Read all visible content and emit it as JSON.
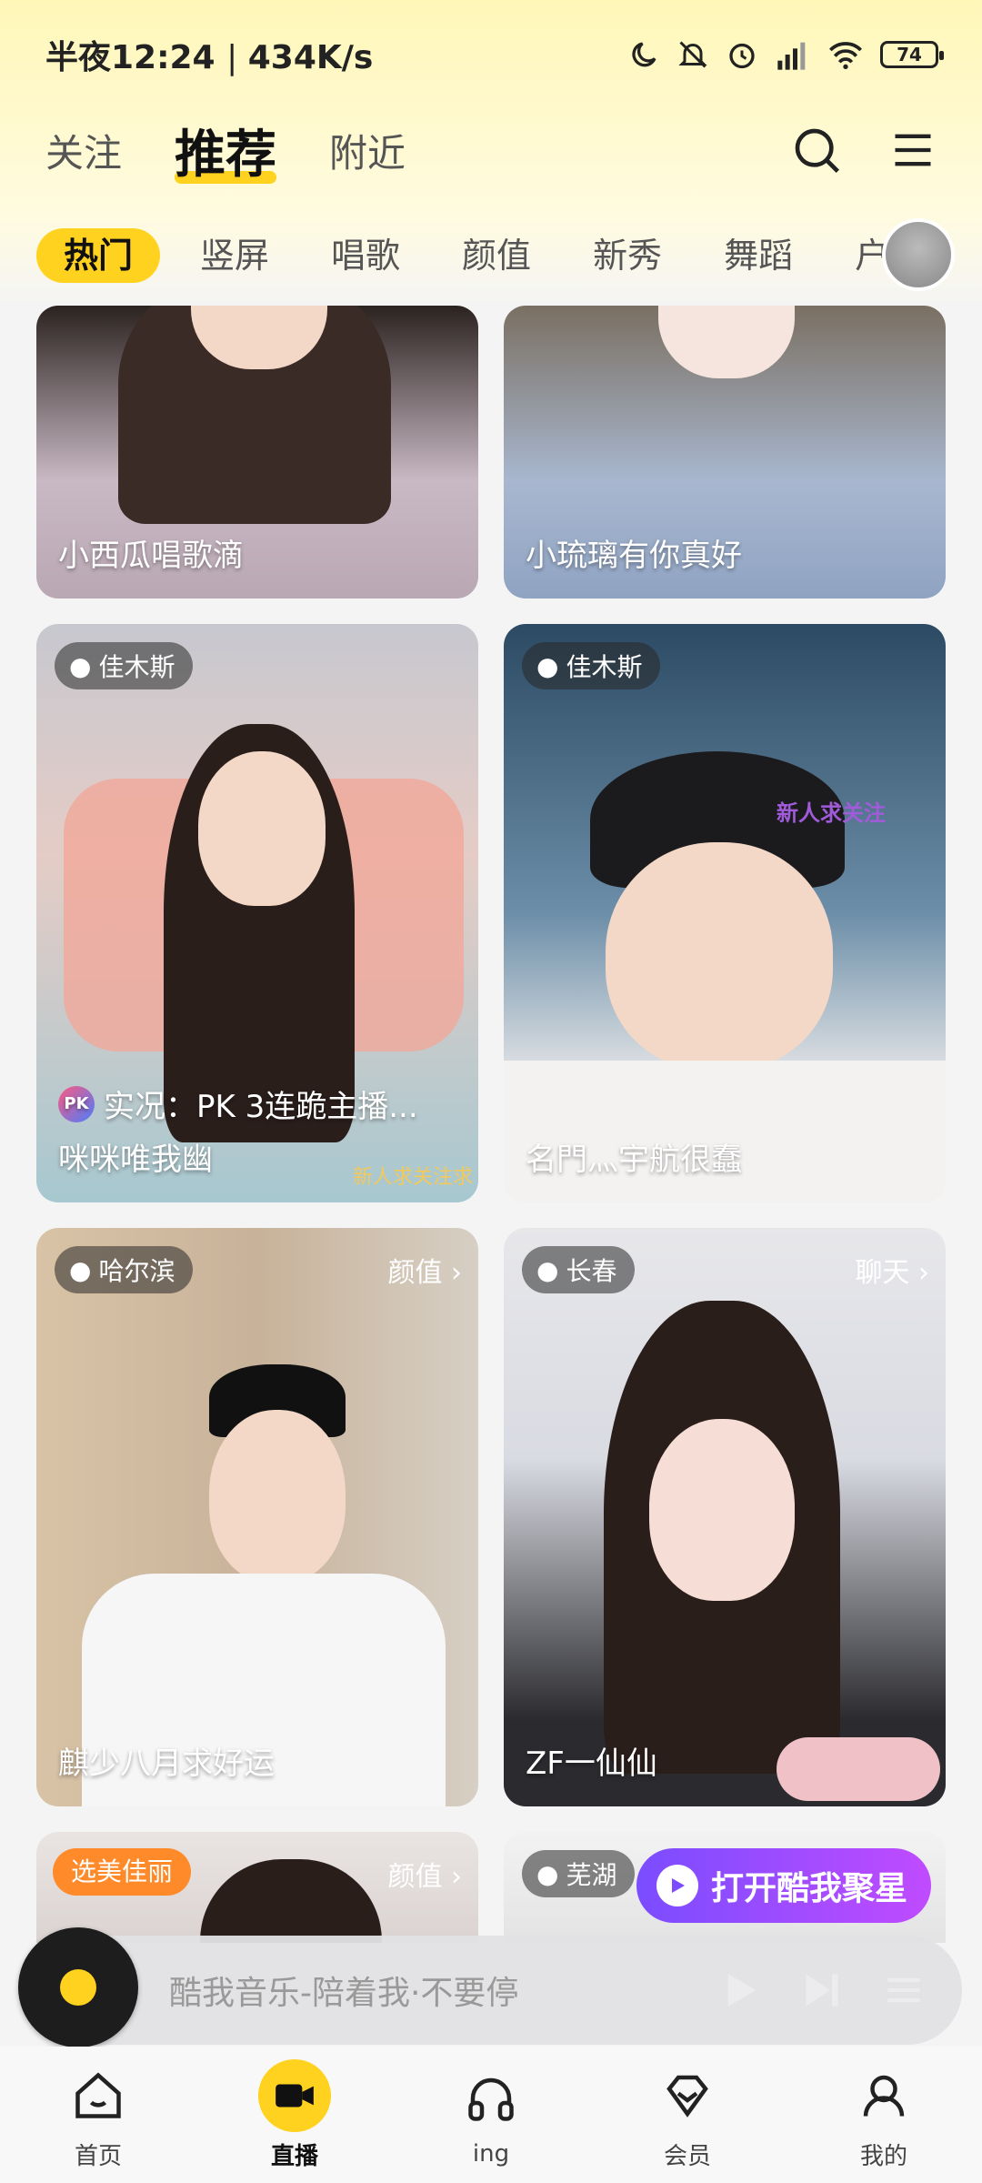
{
  "status": {
    "time": "半夜12:24",
    "speed": "434K/s",
    "battery": "74"
  },
  "header": {
    "tabs": [
      {
        "label": "关注"
      },
      {
        "label": "推荐"
      },
      {
        "label": "附近"
      }
    ]
  },
  "categories": [
    {
      "label": "热门"
    },
    {
      "label": "竖屏"
    },
    {
      "label": "唱歌"
    },
    {
      "label": "颜值"
    },
    {
      "label": "新秀"
    },
    {
      "label": "舞蹈"
    },
    {
      "label": "户"
    }
  ],
  "feed": {
    "cards": [
      {
        "name": "小西瓜唱歌滴"
      },
      {
        "name": "小琉璃有你真好"
      },
      {
        "location": "佳木斯",
        "pk_text": "实况：PK 3连跪主播...",
        "name": "咪咪唯我幽",
        "overlay": "新人求关注求"
      },
      {
        "location": "佳木斯",
        "name": "名門灬宇航很蠢",
        "overlay": "新人求关注"
      },
      {
        "location": "哈尔滨",
        "tag": "颜值 ›",
        "name": "麒少八月求好运"
      },
      {
        "location": "长春",
        "tag": "聊天 ›",
        "name": "ZF一仙仙"
      },
      {
        "chip": "选美佳丽",
        "tag": "颜值 ›"
      },
      {
        "location": "芜湖"
      }
    ]
  },
  "open_app": {
    "label": "打开酷我聚星"
  },
  "music": {
    "title": "酷我音乐-陪着我·不要停"
  },
  "nav": {
    "items": [
      {
        "label": "首页"
      },
      {
        "label": "直播"
      },
      {
        "label": "ing"
      },
      {
        "label": "会员"
      },
      {
        "label": "我的"
      }
    ]
  },
  "colors": {
    "accent": "#ffd21f",
    "purple": "#7b4cff"
  }
}
